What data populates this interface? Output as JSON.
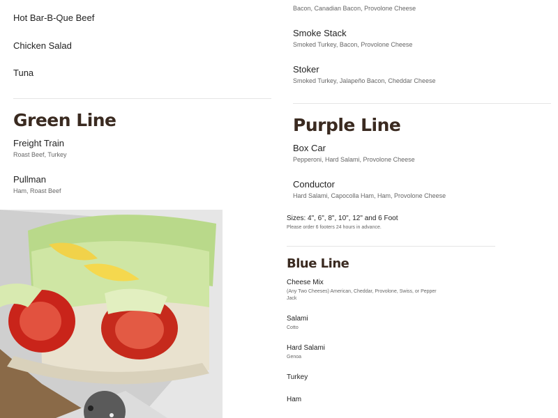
{
  "left_column": {
    "items": [
      {
        "name": "Hot Bar-B-Que Beef"
      },
      {
        "name": "Chicken Salad"
      },
      {
        "name": "Tuna"
      }
    ],
    "green_line": {
      "heading": "Green Line",
      "items": [
        {
          "name": "Freight Train",
          "desc": "Roast Beef, Turkey"
        },
        {
          "name": "Pullman",
          "desc": "Ham, Roast Beef"
        }
      ]
    }
  },
  "right_column": {
    "top_items": [
      {
        "name": "",
        "desc": "Bacon, Canadian Bacon, Provolone Cheese"
      },
      {
        "name": "Smoke Stack",
        "desc": "Smoked Turkey, Bacon, Provolone Cheese"
      },
      {
        "name": "Stoker",
        "desc": "Smoked Turkey, Jalapeño Bacon, Cheddar Cheese"
      }
    ],
    "purple_line": {
      "heading": "Purple Line",
      "items": [
        {
          "name": "Box Car",
          "desc": "Pepperoni, Hard Salami, Provolone Cheese"
        },
        {
          "name": "Conductor",
          "desc": "Hard Salami, Capocolla Ham, Ham, Provolone Cheese"
        }
      ]
    },
    "sizes": {
      "text": "Sizes: 4\", 6\", 8\", 10\", 12\" and 6 Foot",
      "note": "Please order 6 footers 24 hours in advance."
    },
    "blue_line": {
      "heading": "Blue Line",
      "items": [
        {
          "name": "Cheese Mix",
          "desc": "(Any Two Cheeses) American, Cheddar, Provolone, Swiss, or Pepper Jack"
        },
        {
          "name": "Salami",
          "desc": "Cotto"
        },
        {
          "name": "Hard Salami",
          "desc": "Genoa"
        },
        {
          "name": "Turkey",
          "desc": ""
        },
        {
          "name": "Ham",
          "desc": ""
        }
      ]
    }
  },
  "colors": {
    "heading": "#3a2a20",
    "description": "#666666",
    "divider": "#e5e5e5"
  }
}
